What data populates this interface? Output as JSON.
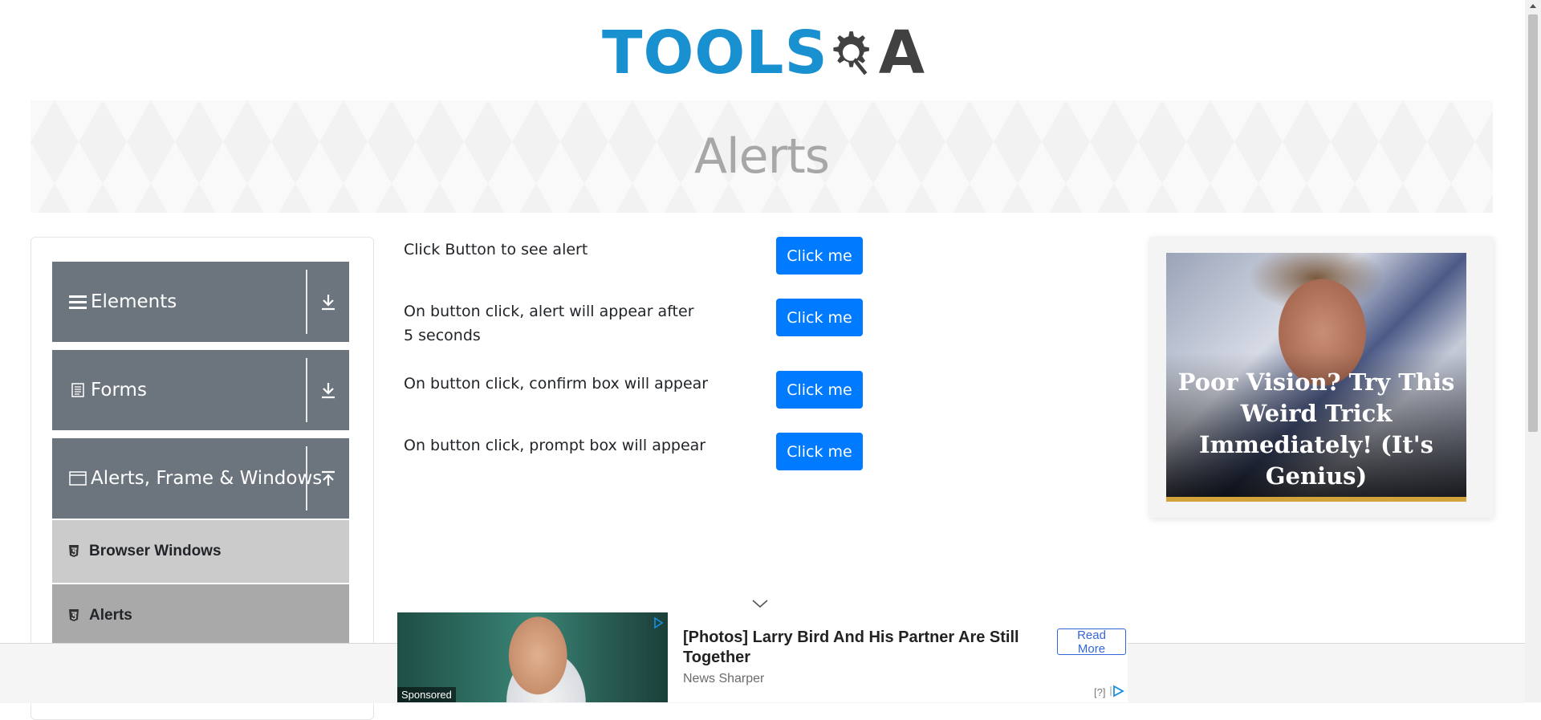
{
  "header": {
    "logo_text_left": "TOOLS",
    "logo_text_right": "A",
    "logo_colors": {
      "tools": "#1990cf",
      "qa": "#414141"
    }
  },
  "banner": {
    "title": "Alerts"
  },
  "sidebar": {
    "groups": [
      {
        "label": "Elements",
        "icon": "hamburger-icon",
        "arrow": "download-arrow-icon"
      },
      {
        "label": "Forms",
        "icon": "document-icon",
        "arrow": "download-arrow-icon"
      },
      {
        "label": "Alerts, Frame & Windows",
        "icon": "window-icon",
        "arrow": "upload-arrow-icon"
      }
    ],
    "items": [
      {
        "label": "Browser Windows",
        "icon": "html5-icon",
        "active": false
      },
      {
        "label": "Alerts",
        "icon": "html5-icon",
        "active": true
      }
    ],
    "colors": {
      "group_bg": "#6c757d",
      "item_bg": "#cbcbcb",
      "item_active_bg": "#a9a9a9"
    }
  },
  "main": {
    "rows": [
      {
        "text": "Click Button to see alert",
        "button": "Click me"
      },
      {
        "text": "On button click, alert will appear after 5 seconds",
        "button": "Click me"
      },
      {
        "text": "On button click, confirm box will appear",
        "button": "Click me"
      },
      {
        "text": "On button click, prompt box will appear",
        "button": "Click me"
      }
    ],
    "button_color": "#007bff"
  },
  "right_ad": {
    "headline": "Poor Vision? Try This Weird Trick Immediately! (It's Genius)"
  },
  "bottom_ad": {
    "sponsored": "Sponsored",
    "title": "[Photos] Larry Bird And His Partner Are Still Together",
    "source": "News Sharper",
    "read_more": "Read More",
    "qmark": "[?]"
  }
}
